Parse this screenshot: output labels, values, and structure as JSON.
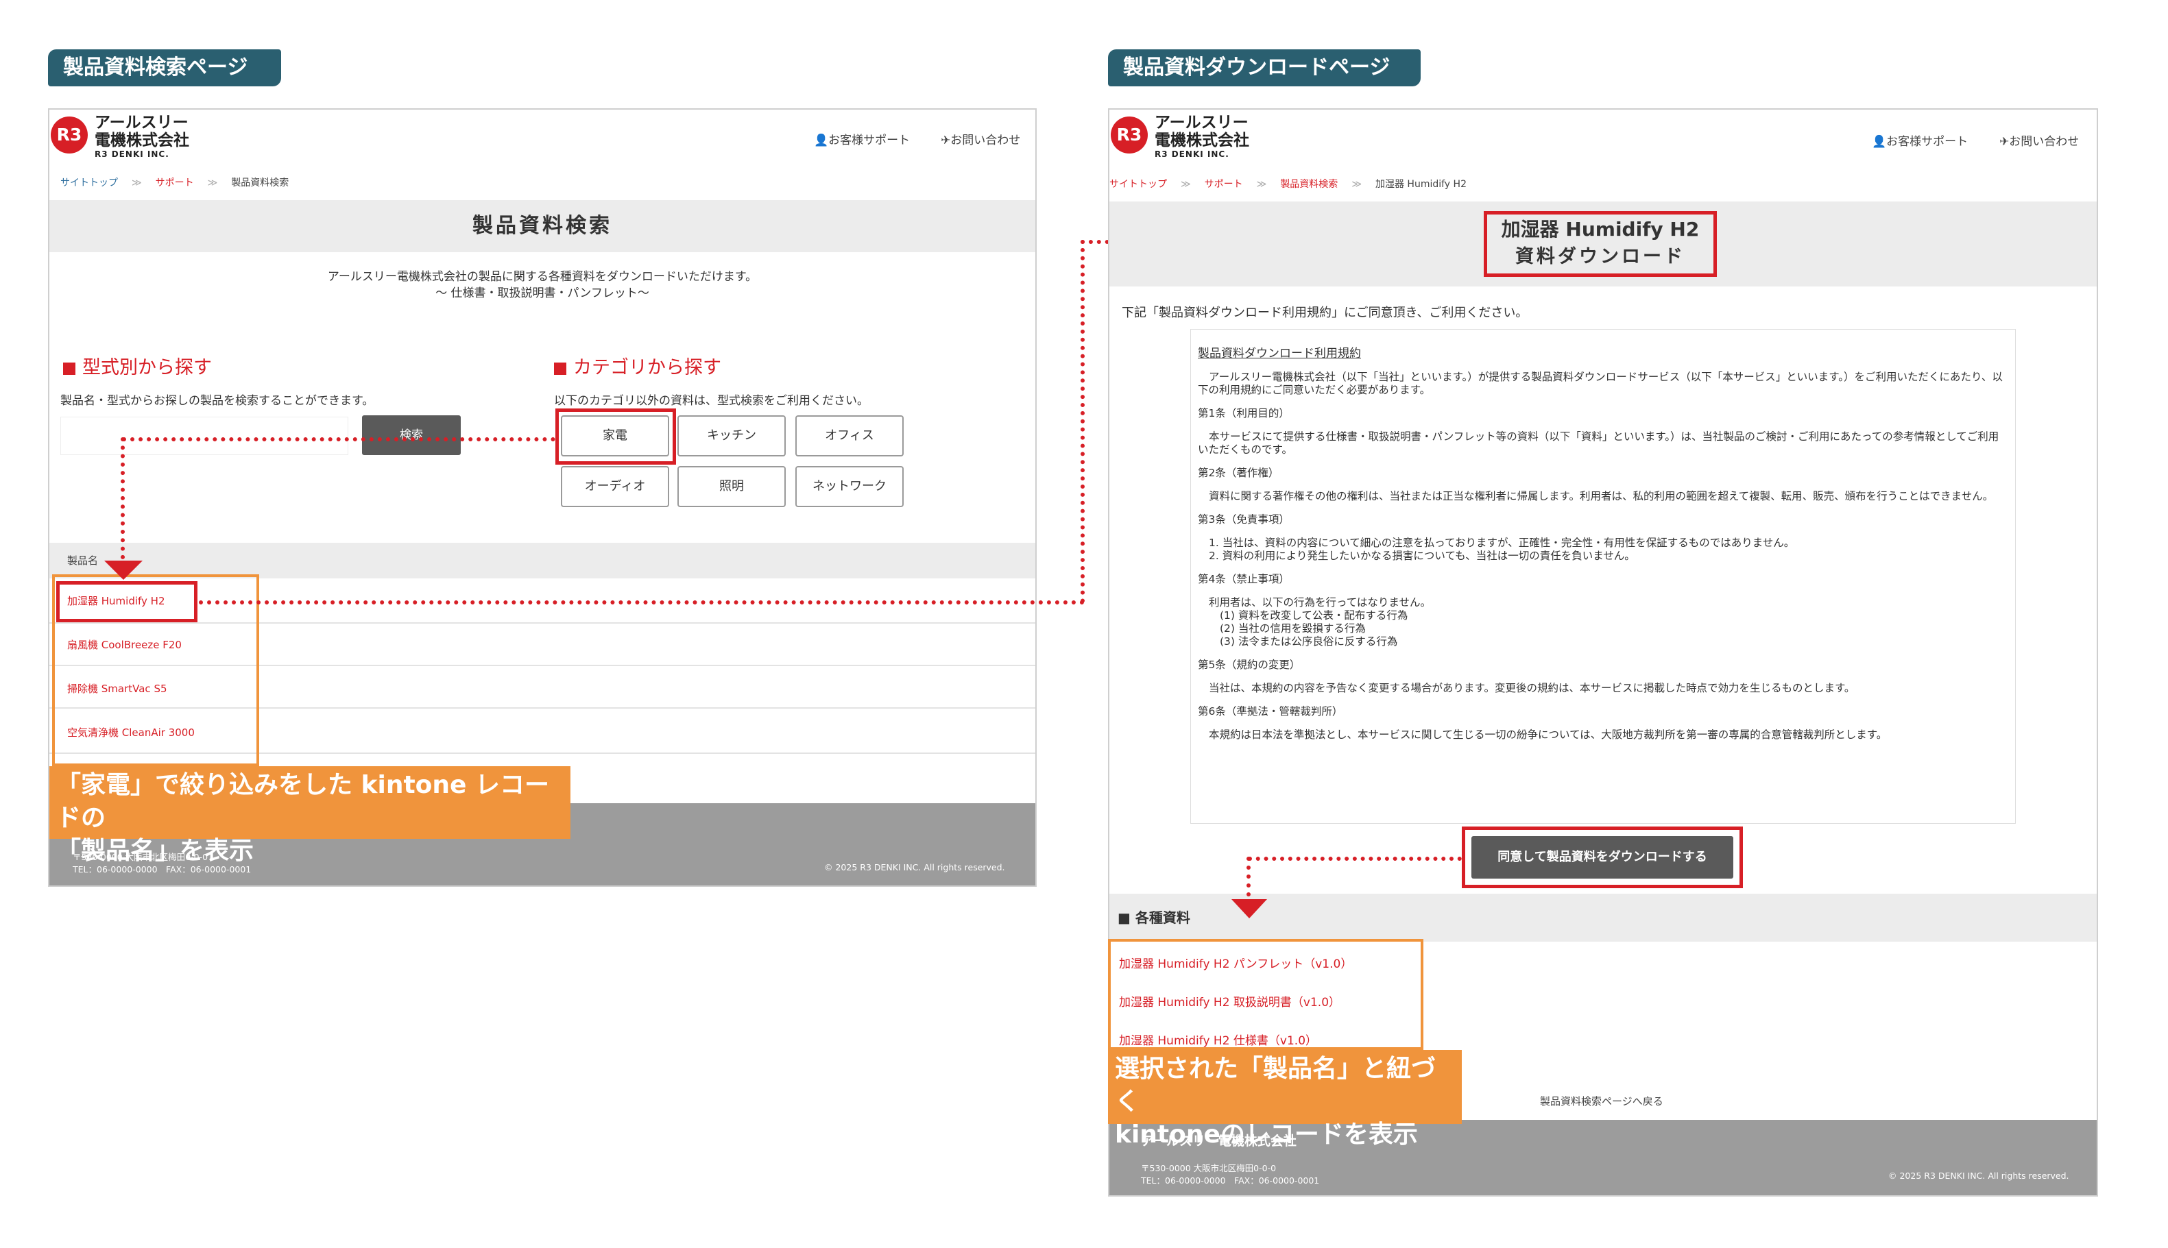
{
  "left": {
    "section_label": "製品資料検索ページ",
    "logo": {
      "mark": "R3",
      "company": "アールスリー",
      "company2": "電機株式会社",
      "sub": "R3 DENKI INC."
    },
    "header_links": {
      "support": "お客様サポート",
      "contact": "お問い合わせ"
    },
    "breadcrumb": {
      "top": "サイトトップ",
      "support": "サポート",
      "current": "製品資料検索",
      "sep": "≫"
    },
    "title": "製品資料検索",
    "intro1": "アールスリー電機株式会社の製品に関する各種資料をダウンロードいただけます。",
    "intro2": "〜 仕様書・取扱説明書・パンフレット〜",
    "model_heading": "型式別から探す",
    "model_desc": "製品名・型式からお探しの製品を検索することができます。",
    "search_placeholder": "",
    "search_button": "検索",
    "category_heading": "カテゴリから探す",
    "category_desc": "以下のカテゴリ以外の資料は、型式検索をご利用ください。",
    "categories": [
      "家電",
      "キッチン",
      "オフィス",
      "オーディオ",
      "照明",
      "ネットワーク"
    ],
    "product_column": "製品名",
    "products": [
      "加湿器 Humidify H2",
      "扇風機 CoolBreeze F20",
      "掃除機 SmartVac S5",
      "空気清浄機 CleanAir 3000"
    ],
    "annotation1": "「家電」で絞り込みをした kintone レコードの",
    "annotation2": "「製品名」を表示",
    "footer_addr1": "〒530-0000 大阪市北区梅田0-0-0",
    "footer_addr2": "TEL：06-0000-0000　FAX：06-0000-0001",
    "footer_copy": "© 2025 R3 DENKI INC. All rights reserved."
  },
  "right": {
    "section_label": "製品資料ダウンロードページ",
    "logo": {
      "mark": "R3",
      "company": "アールスリー",
      "company2": "電機株式会社",
      "sub": "R3 DENKI INC."
    },
    "header_links": {
      "support": "お客様サポート",
      "contact": "お問い合わせ"
    },
    "breadcrumb": {
      "top": "サイトトップ",
      "support": "サポート",
      "search": "製品資料検索",
      "current": "加湿器 Humidify H2",
      "sep": "≫"
    },
    "title1": "加湿器 Humidify H2",
    "title2": "資料ダウンロード",
    "agree_prompt": "下記「製品資料ダウンロード利用規約」にご同意頂き、ご利用ください。",
    "terms": {
      "title": "製品資料ダウンロード利用規約",
      "p0": "アールスリー電機株式会社（以下「当社」といいます。）が提供する製品資料ダウンロードサービス（以下「本サービス」といいます。）をご利用いただくにあたり、以下の利用規約にご同意いただく必要があります。",
      "a1_title": "第1条（利用目的）",
      "a1_body": "本サービスにて提供する仕様書・取扱説明書・パンフレット等の資料（以下「資料」といいます。）は、当社製品のご検討・ご利用にあたっての参考情報としてご利用いただくものです。",
      "a2_title": "第2条（著作権）",
      "a2_body": "資料に関する著作権その他の権利は、当社または正当な権利者に帰属します。利用者は、私的利用の範囲を超えて複製、転用、販売、頒布を行うことはできません。",
      "a3_title": "第3条（免責事項）",
      "a3_body1": "1. 当社は、資料の内容について細心の注意を払っておりますが、正確性・完全性・有用性を保証するものではありません。",
      "a3_body2": "2. 資料の利用により発生したいかなる損害についても、当社は一切の責任を負いません。",
      "a4_title": "第4条（禁止事項）",
      "a4_body0": "利用者は、以下の行為を行ってはなりません。",
      "a4_body1": "(1) 資料を改変して公表・配布する行為",
      "a4_body2": "(2) 当社の信用を毀損する行為",
      "a4_body3": "(3) 法令または公序良俗に反する行為",
      "a5_title": "第5条（規約の変更）",
      "a5_body": "当社は、本規約の内容を予告なく変更する場合があります。変更後の規約は、本サービスに掲載した時点で効力を生じるものとします。",
      "a6_title": "第6条（準拠法・管轄裁判所）",
      "a6_body": "本規約は日本法を準拠法とし、本サービスに関して生じる一切の紛争については、大阪地方裁判所を第一審の専属的合意管轄裁判所とします。"
    },
    "agree_button": "同意して製品資料をダウンロードする",
    "docs_heading": "■ 各種資料",
    "docs": [
      "加湿器 Humidify H2 パンフレット（v1.0）",
      "加湿器 Humidify H2 取扱説明書（v1.0）",
      "加湿器 Humidify H2 仕様書（v1.0）"
    ],
    "annotation1": "選択された「製品名」と紐づく",
    "annotation2": "kintoneのレコードを表示",
    "back_link": "製品資料検索ページへ戻る",
    "footer_company": "アールスリー電機株式会社",
    "footer_addr1": "〒530-0000 大阪市北区梅田0-0-0",
    "footer_addr2": "TEL：06-0000-0000　FAX：06-0000-0001",
    "footer_copy": "© 2025 R3 DENKI INC. All rights reserved."
  }
}
